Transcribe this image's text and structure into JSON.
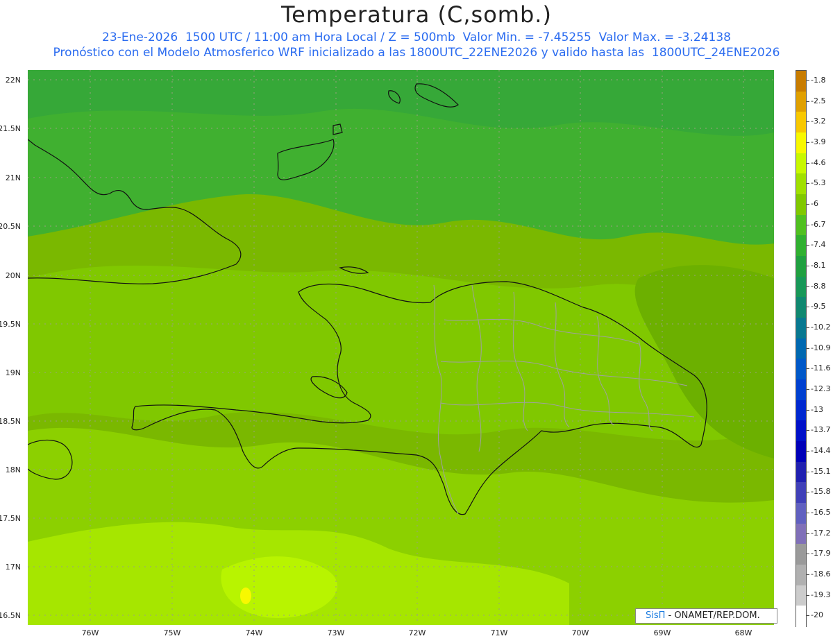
{
  "header": {
    "title": "Temperatura (C,somb.)",
    "subtitle1": "23-Ene-2026  1500 UTC / 11:00 am Hora Local / Z = 500mb  Valor Min. = -7.45255  Valor Max. = -3.24138",
    "subtitle2": "Pronóstico con el Modelo Atmosferico WRF inicializado a las 1800UTC_22ENE2026 y valido hasta las  1800UTC_24ENE2026"
  },
  "axes": {
    "y_labels": [
      "22N",
      "21.5N",
      "21N",
      "20.5N",
      "20N",
      "19.5N",
      "19N",
      "18.5N",
      "18N",
      "17.5N",
      "17N",
      "16.5N"
    ],
    "y_values": [
      22,
      21.5,
      21,
      20.5,
      20,
      19.5,
      19,
      18.5,
      18,
      17.5,
      17,
      16.5
    ],
    "x_labels": [
      "76W",
      "75W",
      "74W",
      "73W",
      "72W",
      "71W",
      "70W",
      "69W",
      "68W"
    ],
    "x_values": [
      -76,
      -75,
      -74,
      -73,
      -72,
      -71,
      -70,
      -69,
      -68
    ],
    "lon_range": [
      -76.65,
      -67.6
    ],
    "lat_range": [
      16.4,
      22.1
    ]
  },
  "colorbar": {
    "labels": [
      "-1.8",
      "-2.5",
      "-3.2",
      "-3.9",
      "-4.6",
      "-5.3",
      "-6",
      "-6.7",
      "-7.4",
      "-8.1",
      "-8.8",
      "-9.5",
      "-10.2",
      "-10.9",
      "-11.6",
      "-12.3",
      "-13",
      "-13.7",
      "-14.4",
      "-15.1",
      "-15.8",
      "-16.5",
      "-17.2",
      "-17.9",
      "-18.6",
      "-19.3",
      "-20"
    ],
    "colors": [
      "#c87c00",
      "#e0a000",
      "#f8c800",
      "#f8f800",
      "#c8f800",
      "#a0e000",
      "#80c800",
      "#50c020",
      "#30b030",
      "#20a040",
      "#189858",
      "#108870",
      "#087890",
      "#0068b0",
      "#0058c8",
      "#0040d0",
      "#0028d0",
      "#0010c8",
      "#0000b8",
      "#2020b0",
      "#4040b8",
      "#6060c0",
      "#8070b8",
      "#9a9a9a",
      "#b0b0b0",
      "#cccccc",
      "#ffffff"
    ]
  },
  "credit": {
    "brand": "SisΠ",
    "text": " - ONAMET/REP.DOM."
  }
}
